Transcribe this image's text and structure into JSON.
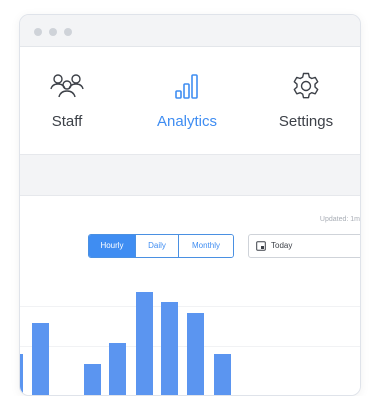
{
  "tabs": [
    {
      "label": "Staff",
      "icon": "staff-icon",
      "active": false
    },
    {
      "label": "Analytics",
      "icon": "analytics-icon",
      "active": true
    },
    {
      "label": "Settings",
      "icon": "settings-icon",
      "active": false
    }
  ],
  "content": {
    "updated_text": "Updated: 1m",
    "range_options": [
      "Hourly",
      "Daily",
      "Monthly"
    ],
    "selected_range": "Hourly",
    "date_value": "Today"
  },
  "colors": {
    "accent": "#3f8df2",
    "bar": "#5b95f0",
    "text": "#3d4148"
  },
  "chart_data": {
    "type": "bar",
    "values": [
      4,
      7,
      0,
      3,
      5,
      10,
      9,
      8,
      4
    ]
  }
}
